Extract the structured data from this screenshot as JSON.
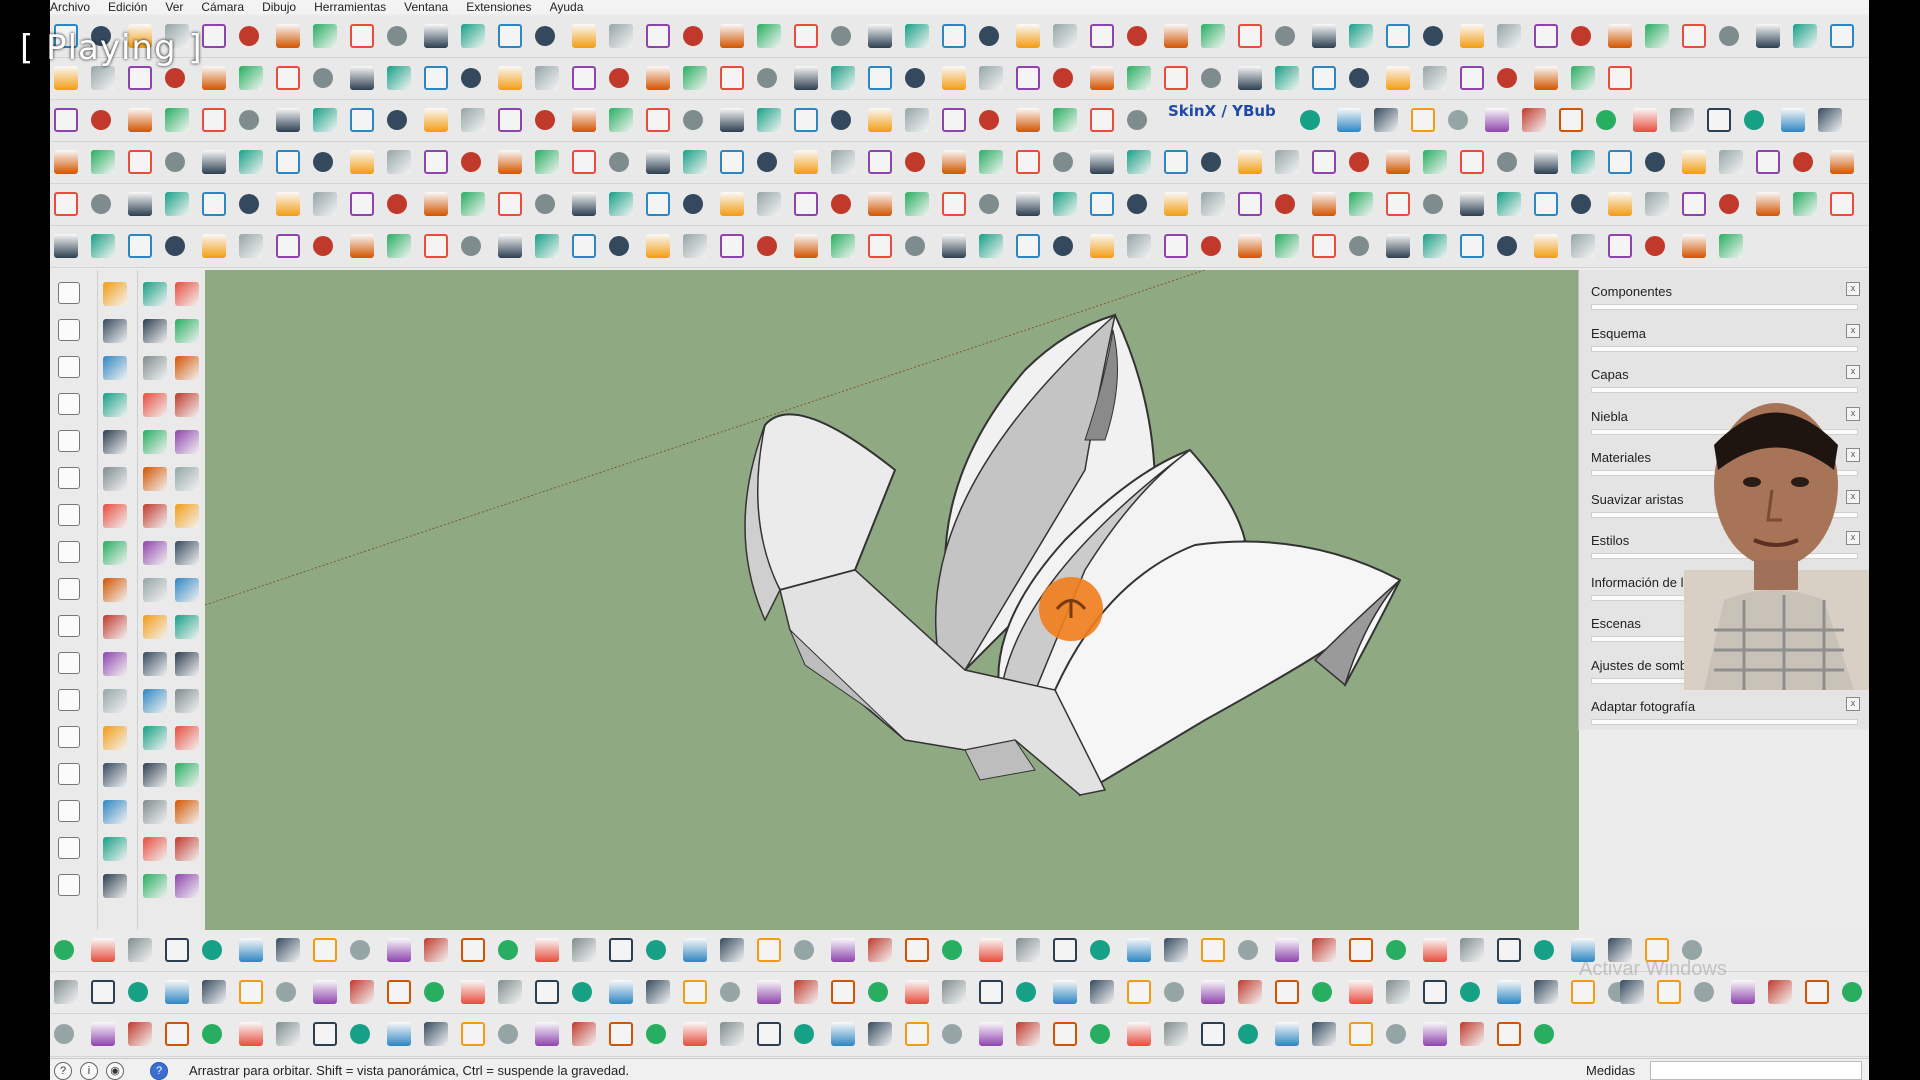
{
  "overlay": {
    "playing_label": "[ Playing ]"
  },
  "menu": [
    "Archivo",
    "Edición",
    "Ver",
    "Cámara",
    "Dibujo",
    "Herramientas",
    "Ventana",
    "Extensiones",
    "Ayuda"
  ],
  "toolbar_text": {
    "skin_label": "SkinX / YBub"
  },
  "tray": {
    "panels": [
      "Componentes",
      "Esquema",
      "Capas",
      "Niebla",
      "Materiales",
      "Suavizar aristas",
      "Estilos",
      "Información de la entidad",
      "Escenas",
      "Ajustes de sombras",
      "Adaptar fotografía"
    ],
    "close_glyph": "x"
  },
  "status": {
    "message": "Arrastrar para orbitar. Shift = vista panorámica, Ctrl = suspende la gravedad.",
    "measure_label": "Medidas",
    "measure_value": ""
  },
  "watermark": "Activar Windows",
  "colors": {
    "viewport_bg": "#8faa83",
    "orbit_cursor": "#f07d1a",
    "model_face": "#f2f2f2",
    "model_shadow": "#b9b9b9"
  },
  "icons": [
    "orbit-icon",
    "pan-icon",
    "zoom-icon",
    "select-arrow-icon",
    "pencil-icon",
    "eraser-icon",
    "paint-bucket-icon",
    "undo-icon",
    "redo-icon",
    "circle-icon",
    "arc-icon",
    "rectangle-icon",
    "move-icon",
    "rotate-icon",
    "scale-icon",
    "push-pull-icon",
    "tape-measure-icon",
    "text-icon"
  ]
}
